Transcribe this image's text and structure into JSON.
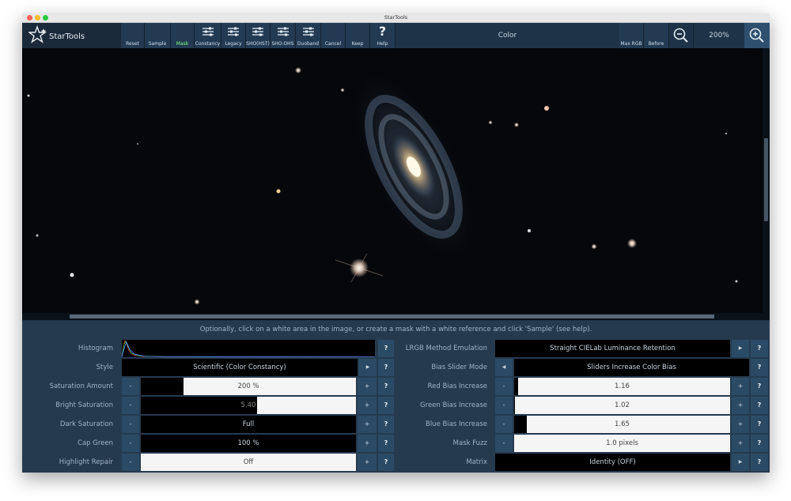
{
  "window": {
    "title": "StarTools"
  },
  "logo": {
    "text": "StarTools"
  },
  "toolbar": {
    "buttons": [
      {
        "label": "Reset",
        "icon": "none"
      },
      {
        "label": "Sample",
        "icon": "none"
      },
      {
        "label": "Mask",
        "icon": "none"
      },
      {
        "label": "Constancy",
        "icon": "sliders-icon"
      },
      {
        "label": "Legacy",
        "icon": "sliders-icon"
      },
      {
        "label": "SHO(HST)",
        "icon": "sliders-icon"
      },
      {
        "label": "SHO:OHS",
        "icon": "sliders-icon"
      },
      {
        "label": "Duoband",
        "icon": "sliders-icon"
      },
      {
        "label": "Cancel",
        "icon": "none"
      },
      {
        "label": "Keep",
        "icon": "none"
      },
      {
        "label": "Help",
        "icon": "question-icon",
        "glyph": "?"
      }
    ],
    "mode_title": "Color",
    "right_buttons": [
      {
        "label": "Max RGB"
      },
      {
        "label": "Before"
      }
    ],
    "zoom": "200%"
  },
  "hint": "Optionally, click on a white area in the image, or create a mask with a white reference and click 'Sample' (see help).",
  "controls": {
    "minus": "-",
    "plus": "+",
    "help": "?",
    "left_arrow": "◀",
    "right_arrow": "▶"
  },
  "left_params": {
    "histogram": {
      "label": "Histogram"
    },
    "style": {
      "label": "Style",
      "value": "Scientific (Color Constancy)"
    },
    "saturation_amount": {
      "label": "Saturation Amount",
      "value": "200 %",
      "fraction": 0.2
    },
    "bright_saturation": {
      "label": "Bright Saturation",
      "value": "5.40",
      "fraction": 0.54
    },
    "dark_saturation": {
      "label": "Dark Saturation",
      "value": "Full",
      "fraction": 1.0
    },
    "cap_green": {
      "label": "Cap Green",
      "value": "100 %",
      "fraction": 1.0
    },
    "highlight_repair": {
      "label": "Highlight Repair",
      "value": "Off",
      "fraction": 0.0
    }
  },
  "right_params": {
    "lrgb_method": {
      "label": "LRGB Method Emulation",
      "value": "Straight CIELab Luminance Retention"
    },
    "bias_slider_mode": {
      "label": "Bias Slider Mode",
      "value": "Sliders Increase Color Bias"
    },
    "red_bias": {
      "label": "Red Bias Increase",
      "value": "1.16",
      "fraction": 0.02
    },
    "green_bias": {
      "label": "Green Bias Increase",
      "value": "1.02",
      "fraction": 0.005
    },
    "blue_bias": {
      "label": "Blue Bias Increase",
      "value": "1.65",
      "fraction": 0.06
    },
    "mask_fuzz": {
      "label": "Mask Fuzz",
      "value": "1.0 pixels",
      "fraction": 0.0
    },
    "matrix": {
      "label": "Matrix",
      "value": "Identity (OFF)"
    }
  },
  "colors": {
    "panel": "#263a4e",
    "button": "#2b4a66",
    "accent_green": "#7dff7d"
  }
}
